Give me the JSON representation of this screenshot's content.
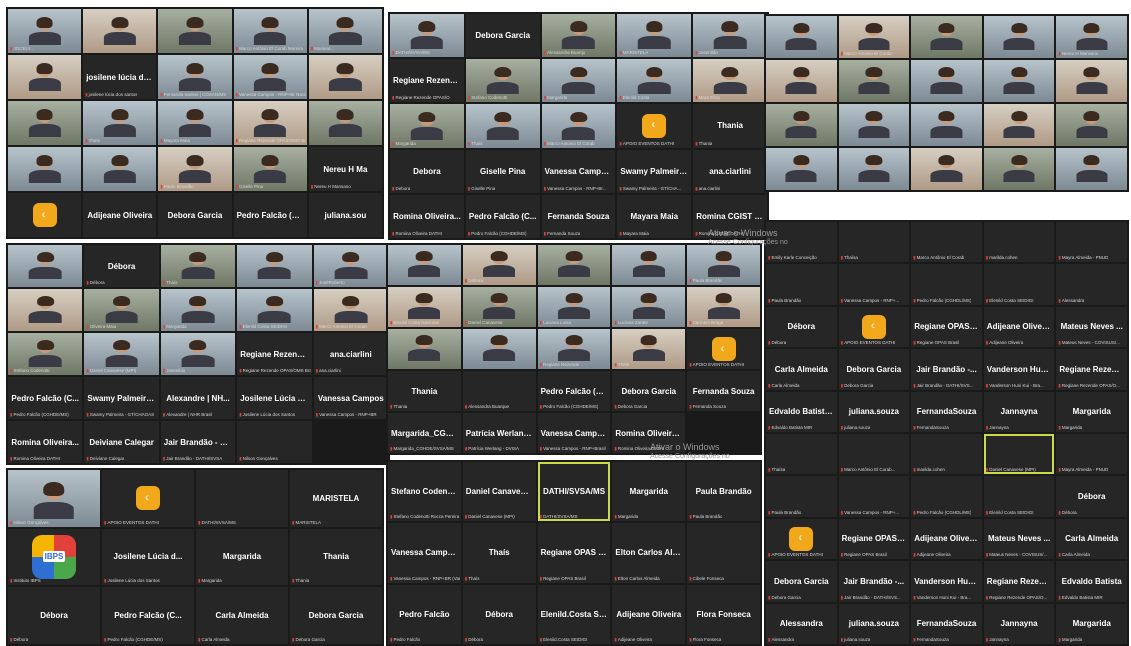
{
  "screenshots": {
    "s1": {
      "tiles": [
        {
          "name": "",
          "label": "JOCELY..."
        },
        {
          "name": "",
          "label": ""
        },
        {
          "name": "",
          "label": ""
        },
        {
          "name": "",
          "label": "Marco Antônio El Corab Moreira"
        },
        {
          "name": "",
          "label": "Mariana..."
        },
        {
          "name": "",
          "label": ""
        },
        {
          "name": "josilene lúcia do...",
          "label": "josilene lúcia dos santos"
        },
        {
          "name": "",
          "label": "Fernanda Santos | COSAN/MS"
        },
        {
          "name": "",
          "label": "Vanessa Campos - RNP+Br Nacional"
        },
        {
          "name": "",
          "label": ""
        },
        {
          "name": "",
          "label": ""
        },
        {
          "name": "",
          "label": "Thaís"
        },
        {
          "name": "",
          "label": "Mayara Maia"
        },
        {
          "name": "",
          "label": "Regiane Rezende OPAS/OMS Brasil"
        },
        {
          "name": "",
          "label": ""
        },
        {
          "name": "",
          "label": ""
        },
        {
          "name": "",
          "label": ""
        },
        {
          "name": "",
          "label": "Paulo Brandão"
        },
        {
          "name": "",
          "label": "Giselle Pina"
        },
        {
          "name": "Nereu H Ma",
          "label": "Nereu H Mansano"
        },
        {
          "name": "LOGO",
          "label": ""
        },
        {
          "name": "Adijeane Oliveira",
          "label": ""
        },
        {
          "name": "Debora Garcia",
          "label": ""
        },
        {
          "name": "Pedro Falcão (C...",
          "label": ""
        },
        {
          "name": "juliana.sou",
          "label": ""
        }
      ]
    },
    "s2": {
      "tiles": [
        {
          "name": "",
          "label": "DATHI/SVSA/MS"
        },
        {
          "name": "Debora Garcia",
          "label": ""
        },
        {
          "name": "",
          "label": "Alessandra Buarqu"
        },
        {
          "name": "",
          "label": "MARISTELA"
        },
        {
          "name": "",
          "label": "Josenildo"
        },
        {
          "name": "Regiane Rezend...",
          "label": "Regiane Rezende OPAS/O"
        },
        {
          "name": "",
          "label": "Stefano Codenotti"
        },
        {
          "name": "",
          "label": "Margarida"
        },
        {
          "name": "",
          "label": "Elenild Costa"
        },
        {
          "name": "",
          "label": "Mara Elias"
        },
        {
          "name": "",
          "label": "Margarida"
        },
        {
          "name": "",
          "label": "Thaís"
        },
        {
          "name": "",
          "label": "Marco Antonio El Corab"
        },
        {
          "name": "LOGO",
          "label": "APOIO EVENTOS DATHI"
        },
        {
          "name": "Thania",
          "label": "Thania"
        },
        {
          "name": "Debora",
          "label": "Debora"
        },
        {
          "name": "Giselle Pina",
          "label": "Giselle Pina"
        },
        {
          "name": "Vanessa Campos ...",
          "label": "Vanessa Campos - RNP+Br..."
        },
        {
          "name": "Swamy Palmeira ...",
          "label": "Swamy Palmeira - GT/CHA..."
        },
        {
          "name": "ana.ciarlini",
          "label": "ana.ciarlini"
        },
        {
          "name": "Romina Oliveira...",
          "label": "Romina Oliveira DATHI"
        },
        {
          "name": "Pedro Falcão (C...",
          "label": "Pedro Falcão (CGHDE/MS)"
        },
        {
          "name": "Fernanda Souza",
          "label": "Fernanda Souza"
        },
        {
          "name": "Mayara Maia",
          "label": "Mayara Maia"
        },
        {
          "name": "Romina CGIST D...",
          "label": "Romina CGIST DATHI"
        }
      ]
    },
    "s3": {
      "tiles": [
        {
          "name": "",
          "label": ""
        },
        {
          "name": "",
          "label": "Marco Antonio El Corab"
        },
        {
          "name": "",
          "label": ""
        },
        {
          "name": "",
          "label": ""
        },
        {
          "name": "",
          "label": "Nereu H Mansano"
        },
        {
          "name": "",
          "label": ""
        },
        {
          "name": "",
          "label": ""
        },
        {
          "name": "",
          "label": ""
        },
        {
          "name": "",
          "label": ""
        },
        {
          "name": "",
          "label": ""
        },
        {
          "name": "",
          "label": ""
        },
        {
          "name": "",
          "label": ""
        },
        {
          "name": "",
          "label": ""
        },
        {
          "name": "",
          "label": ""
        },
        {
          "name": "",
          "label": ""
        },
        {
          "name": "",
          "label": ""
        },
        {
          "name": "",
          "label": ""
        },
        {
          "name": "",
          "label": ""
        },
        {
          "name": "",
          "label": ""
        },
        {
          "name": "",
          "label": ""
        }
      ]
    },
    "s4": {
      "tiles": [
        {
          "name": "",
          "label": "Emily Karle Conceição"
        },
        {
          "name": "",
          "label": "Thaísa"
        },
        {
          "name": "",
          "label": "Marco Antônio El Corab"
        },
        {
          "name": "",
          "label": "marilda.cohen"
        },
        {
          "name": "",
          "label": "Mayra Almeida - PNUD"
        },
        {
          "name": "",
          "label": "Paula Brandão"
        },
        {
          "name": "",
          "label": "Vanessa Campos - RNP+..."
        },
        {
          "name": "",
          "label": "Pedro Falcão (CGHDL/MS)"
        },
        {
          "name": "",
          "label": "Elenild Costa SEIDIGI"
        },
        {
          "name": "",
          "label": "Alessandra"
        },
        {
          "name": "Débora",
          "label": "Débora"
        },
        {
          "name": "LOGO",
          "label": "APOIO EVENTOS DATHI"
        },
        {
          "name": "Regiane OPAS B...",
          "label": "Regiane OPAS Brasil"
        },
        {
          "name": "Adijeane Oliveira",
          "label": "Adijeane Oliveira"
        },
        {
          "name": "Mateus Neves ...",
          "label": "Mateus Neves - COVISUS/..."
        },
        {
          "name": "Carla Almeida",
          "label": "Carla Almeida"
        },
        {
          "name": "Debora Garcia",
          "label": "Debora Garcia"
        },
        {
          "name": "Jair Brandão -...",
          "label": "Jair Brandão - DATHI/SVS..."
        },
        {
          "name": "Vanderson Huni...",
          "label": "Vanderson Huni Kui - Bra..."
        },
        {
          "name": "Regiane Rezend...",
          "label": "Regiane Rezende OPAS/O..."
        },
        {
          "name": "Edvaldo Batista...",
          "label": "Edvaldo Batista MIR"
        },
        {
          "name": "juliana.souza",
          "label": "juliana.souza"
        },
        {
          "name": "FernandaSouza",
          "label": "FernandaSouza"
        },
        {
          "name": "Jannayna",
          "label": "Jannayna"
        },
        {
          "name": "Margarida",
          "label": "Margarida"
        },
        {
          "name": "",
          "label": "Thaísa"
        },
        {
          "name": "",
          "label": "Marco Antônio El Corab..."
        },
        {
          "name": "",
          "label": "marilda.cohen"
        },
        {
          "name": "",
          "label": "Daniel Canavese (MPI)"
        },
        {
          "name": "",
          "label": "Mayra Almeida - PNUD"
        },
        {
          "name": "",
          "label": "Paula Brandão"
        },
        {
          "name": "",
          "label": "Vanessa Campos - RNP+..."
        },
        {
          "name": "",
          "label": "Pedro Falcão (CGHDL/MS)"
        },
        {
          "name": "",
          "label": "Elenild Costa SEIDIGI"
        },
        {
          "name": "Débora",
          "label": "Débora"
        },
        {
          "name": "LOGO",
          "label": "APOIO EVENTOS DATHI"
        },
        {
          "name": "Regiane OPAS B...",
          "label": "Regiane OPAS Brasil"
        },
        {
          "name": "Adijeane Oliveira",
          "label": "Adijeane Oliveira"
        },
        {
          "name": "Mateus Neves ...",
          "label": "Mateus Neves - COVISUS/..."
        },
        {
          "name": "Carla Almeida",
          "label": "Carla Almeida"
        },
        {
          "name": "Debora Garcia",
          "label": "Debora Garcia"
        },
        {
          "name": "Jair Brandão -...",
          "label": "Jair Brandão - DATHI/SVS..."
        },
        {
          "name": "Vanderson Huni...",
          "label": "Vanderson Huni Kui - Bra..."
        },
        {
          "name": "Regiane Rezend...",
          "label": "Regiane Rezende OPAS/O..."
        },
        {
          "name": "Edvaldo Batista",
          "label": "Edvaldo Batista MIR"
        },
        {
          "name": "Alessandra",
          "label": "Alessandra"
        },
        {
          "name": "juliana.souza",
          "label": "juliana.souza"
        },
        {
          "name": "FernandaSouza",
          "label": "FernandaSouza"
        },
        {
          "name": "Jannayna",
          "label": "Jannayna"
        },
        {
          "name": "Margarida",
          "label": "Margarida"
        }
      ]
    },
    "s5": {
      "tiles": [
        {
          "name": "",
          "label": ""
        },
        {
          "name": "Débora",
          "label": "Débora"
        },
        {
          "name": "",
          "label": "Thaís"
        },
        {
          "name": "",
          "label": ""
        },
        {
          "name": "",
          "label": "JoséRoberto"
        },
        {
          "name": "",
          "label": ""
        },
        {
          "name": "",
          "label": "Oliveira Maia"
        },
        {
          "name": "",
          "label": "Margarida"
        },
        {
          "name": "",
          "label": "Elenild Costa SEIDIGI"
        },
        {
          "name": "",
          "label": "Marco Antonio El Corab"
        },
        {
          "name": "",
          "label": "Stefano Codenotti"
        },
        {
          "name": "",
          "label": "Daniel Canavese (MPI)"
        },
        {
          "name": "",
          "label": "Josenildo"
        },
        {
          "name": "Regiane Rezend...",
          "label": "Regiane Rezende OPAS/OMS Brasil"
        },
        {
          "name": "ana.ciarlini",
          "label": "ana.ciarlini"
        },
        {
          "name": "Pedro Falcão (C...",
          "label": "Pedro Falcão (CGHDE/MS)"
        },
        {
          "name": "Swamy Palmeira...",
          "label": "Swamy Palmeira - GT/CHAGAS"
        },
        {
          "name": "Alexandre | NH...",
          "label": "Alexandre | NHR Brasil"
        },
        {
          "name": "Josilene Lúcia d...",
          "label": "Josilene Lúcia dos Santos"
        },
        {
          "name": "Vanessa Campos",
          "label": "Vanessa Campos - RNP+BR"
        },
        {
          "name": "Romina Oliveira...",
          "label": "Romina Oliveira DATHI"
        },
        {
          "name": "Deiviane Calegar",
          "label": "Deiviane Calegar"
        },
        {
          "name": "Jair Brandão - D...",
          "label": "Jair Brandão - DATHI/SVSA"
        },
        {
          "name": "",
          "label": "Nilson Gonçalves"
        }
      ]
    },
    "s6": {
      "tiles": [
        {
          "name": "",
          "label": ""
        },
        {
          "name": "",
          "label": "Débora"
        },
        {
          "name": "",
          "label": ""
        },
        {
          "name": "",
          "label": ""
        },
        {
          "name": "",
          "label": "Paula Brandão"
        },
        {
          "name": "",
          "label": "Elenild Costa Nacional"
        },
        {
          "name": "",
          "label": "Daniel Canavese"
        },
        {
          "name": "",
          "label": "Luciana Luisa"
        },
        {
          "name": "",
          "label": "Luciana Zarate"
        },
        {
          "name": "",
          "label": "Carmem Braga"
        },
        {
          "name": "",
          "label": ""
        },
        {
          "name": "",
          "label": ""
        },
        {
          "name": "",
          "label": "Regiane Rezende"
        },
        {
          "name": "",
          "label": "Thaís"
        },
        {
          "name": "LOGO",
          "label": "APOIO EVENTOS DATHI"
        },
        {
          "name": "Thania",
          "label": "Thania"
        },
        {
          "name": "",
          "label": "Alessandra Buarque"
        },
        {
          "name": "Pedro Falcão (C...",
          "label": "Pedro Falcão (CGHDE/MS)"
        },
        {
          "name": "Debora Garcia",
          "label": "Debora Garcia"
        },
        {
          "name": "Fernanda Souza",
          "label": "Fernanda Souza"
        },
        {
          "name": "Margarida_CGH...",
          "label": "Margarida_CGHDE/SVSA/MS"
        },
        {
          "name": "Patrícia Werlang...",
          "label": "Patrícia Werlang - DVISA"
        },
        {
          "name": "Vanessa Campos...",
          "label": "Vanessa Campos - RNP+Brasil"
        },
        {
          "name": "Romina Oliveira...",
          "label": "Romina Oliveira DATHI"
        }
      ]
    },
    "s7": {
      "tiles": [
        {
          "name": "",
          "label": "Nilson Gonçalves"
        },
        {
          "name": "LOGO",
          "label": "APOIO EVENTOS DATHI"
        },
        {
          "name": "",
          "label": "DATHI/SVSA/MS"
        },
        {
          "name": "MARISTELA",
          "label": "MARISTELA"
        },
        {
          "name": "IBPS",
          "label": "Instituto IBPS"
        },
        {
          "name": "Josilene Lúcia d...",
          "label": "Josilene Lúcia dos Santos"
        },
        {
          "name": "Margarida",
          "label": "Margarida"
        },
        {
          "name": "Thania",
          "label": "Thania"
        },
        {
          "name": "Débora",
          "label": "Débora"
        },
        {
          "name": "Pedro Falcão (C...",
          "label": "Pedro Falcão (CGHDE/MS)"
        },
        {
          "name": "Carla Almeida",
          "label": "Carla Almeida"
        },
        {
          "name": "Debora Garcia",
          "label": "Debora Garcia"
        }
      ]
    },
    "s8": {
      "tiles": [
        {
          "name": "Stefano Codenot...",
          "label": "Stefano Codenotti Rocca Pereira"
        },
        {
          "name": "Daniel Canavese...",
          "label": "Daniel Canavese (MPI)"
        },
        {
          "name": "DATHI/SVSA/MS",
          "label": "DATHI/SVSA/MS"
        },
        {
          "name": "Margarida",
          "label": "Margarida"
        },
        {
          "name": "Paula Brandão",
          "label": "Paula Brandão"
        },
        {
          "name": "Vanessa Campos...",
          "label": "Vanessa Campos - RNP+BR (Vanessa Nunes)"
        },
        {
          "name": "Thaís",
          "label": "Thaís"
        },
        {
          "name": "Regiane OPAS Br...",
          "label": "Regiane OPAS Brasil"
        },
        {
          "name": "Elton Carlos Alm...",
          "label": "Elton Carlos Almeida"
        },
        {
          "name": "",
          "label": "Cibele Fonseca"
        },
        {
          "name": "Pedro Falcão",
          "label": "Pedro Falcão"
        },
        {
          "name": "Débora",
          "label": "Débora"
        },
        {
          "name": "Elenild.Costa SEI...",
          "label": "Elenild.Costa SEIDIGI"
        },
        {
          "name": "Adijeane Oliveira",
          "label": "Adijeane Oliveira"
        },
        {
          "name": "Flora Fonseca",
          "label": "Flora Fonseca"
        }
      ]
    }
  },
  "watermarks": {
    "w1_line1": "Ativar o Windows",
    "w1_line2": "Acesse Configurações no",
    "w2_line1": "Ativar o Windows",
    "w2_line2": "Acesse Configurações no"
  },
  "colors": {
    "mic_muted": "#e0403a",
    "active_speaker": "#c8d94a",
    "logo": "#f2a81b"
  }
}
